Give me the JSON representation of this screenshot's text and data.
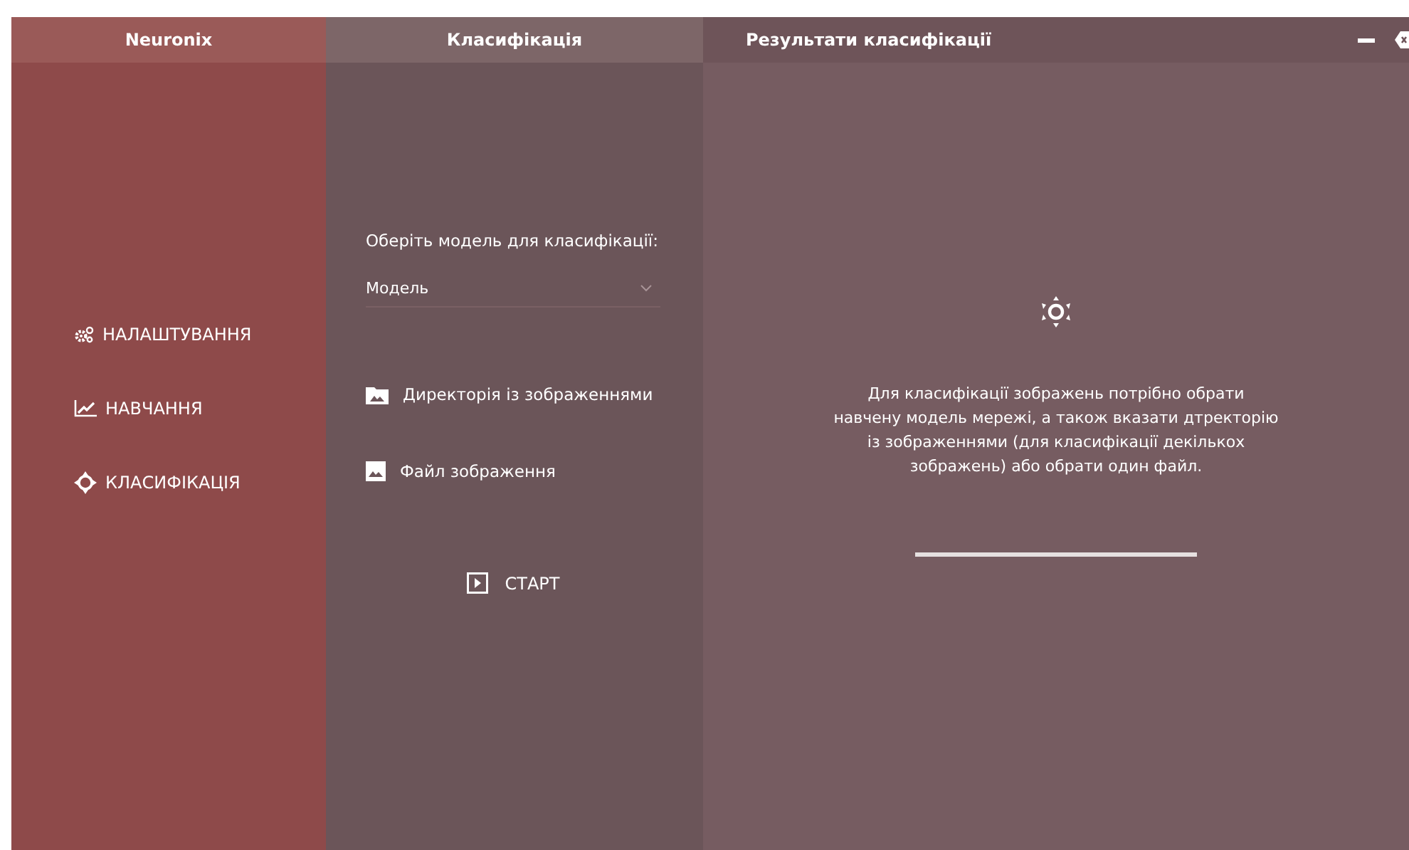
{
  "sidebar": {
    "title": "Neuronix",
    "items": [
      {
        "label": "НАЛАШТУВАННЯ"
      },
      {
        "label": "НАВЧАННЯ"
      },
      {
        "label": "КЛАСИФІКАЦІЯ"
      }
    ]
  },
  "classification": {
    "title": "Класифікація",
    "model_prompt": "Оберіть модель для класифікації:",
    "model_select": {
      "placeholder": "Модель"
    },
    "sources": [
      {
        "label": "Директорія із зображеннями"
      },
      {
        "label": "Файл зображення"
      }
    ],
    "start_button": "СТАРТ"
  },
  "results": {
    "title": "Результати класифікації",
    "message": "Для класифікації зображень потрібно обрати навчену модель мережі, а також вказати дтректорію із зображеннями (для класифікації декількох зображень) або обрати один файл."
  }
}
